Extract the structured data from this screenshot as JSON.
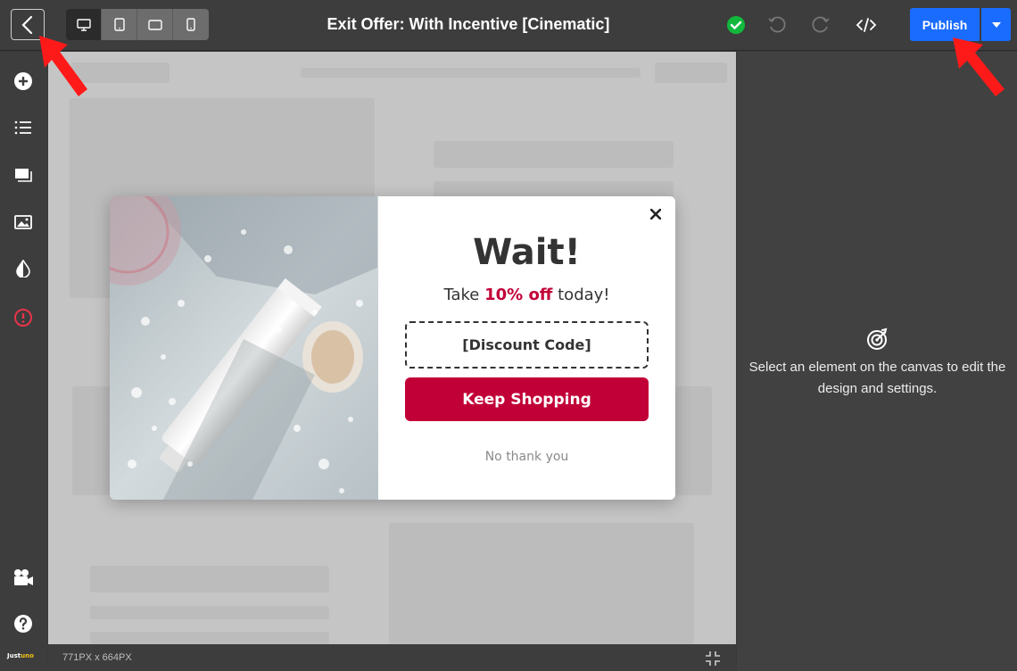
{
  "header": {
    "title": "Exit Offer: With Incentive [Cinematic]",
    "publish_label": "Publish",
    "devices": [
      "desktop-icon",
      "tablet-icon",
      "tablet-landscape-icon",
      "mobile-icon"
    ],
    "accent_color": "#1a6cff",
    "status_color": "#12b83c"
  },
  "sidebar": {
    "items": [
      "add-icon",
      "layers-icon",
      "templates-icon",
      "image-icon",
      "theme-icon",
      "alert-icon"
    ],
    "bottom_items": [
      "video-icon",
      "help-icon"
    ],
    "brand_prefix": "Just",
    "brand_suffix": "uno"
  },
  "popup": {
    "headline": "Wait!",
    "offer_prefix": "Take ",
    "offer_highlight": "10% off",
    "offer_suffix": " today!",
    "code_text": "[Discount Code]",
    "cta_label": "Keep Shopping",
    "decline_label": "No thank you",
    "accent_color": "#c20038"
  },
  "status_bar": {
    "size_text": "771PX x 664PX"
  },
  "right_panel": {
    "message": "Select an element on the canvas to edit the design and settings."
  }
}
